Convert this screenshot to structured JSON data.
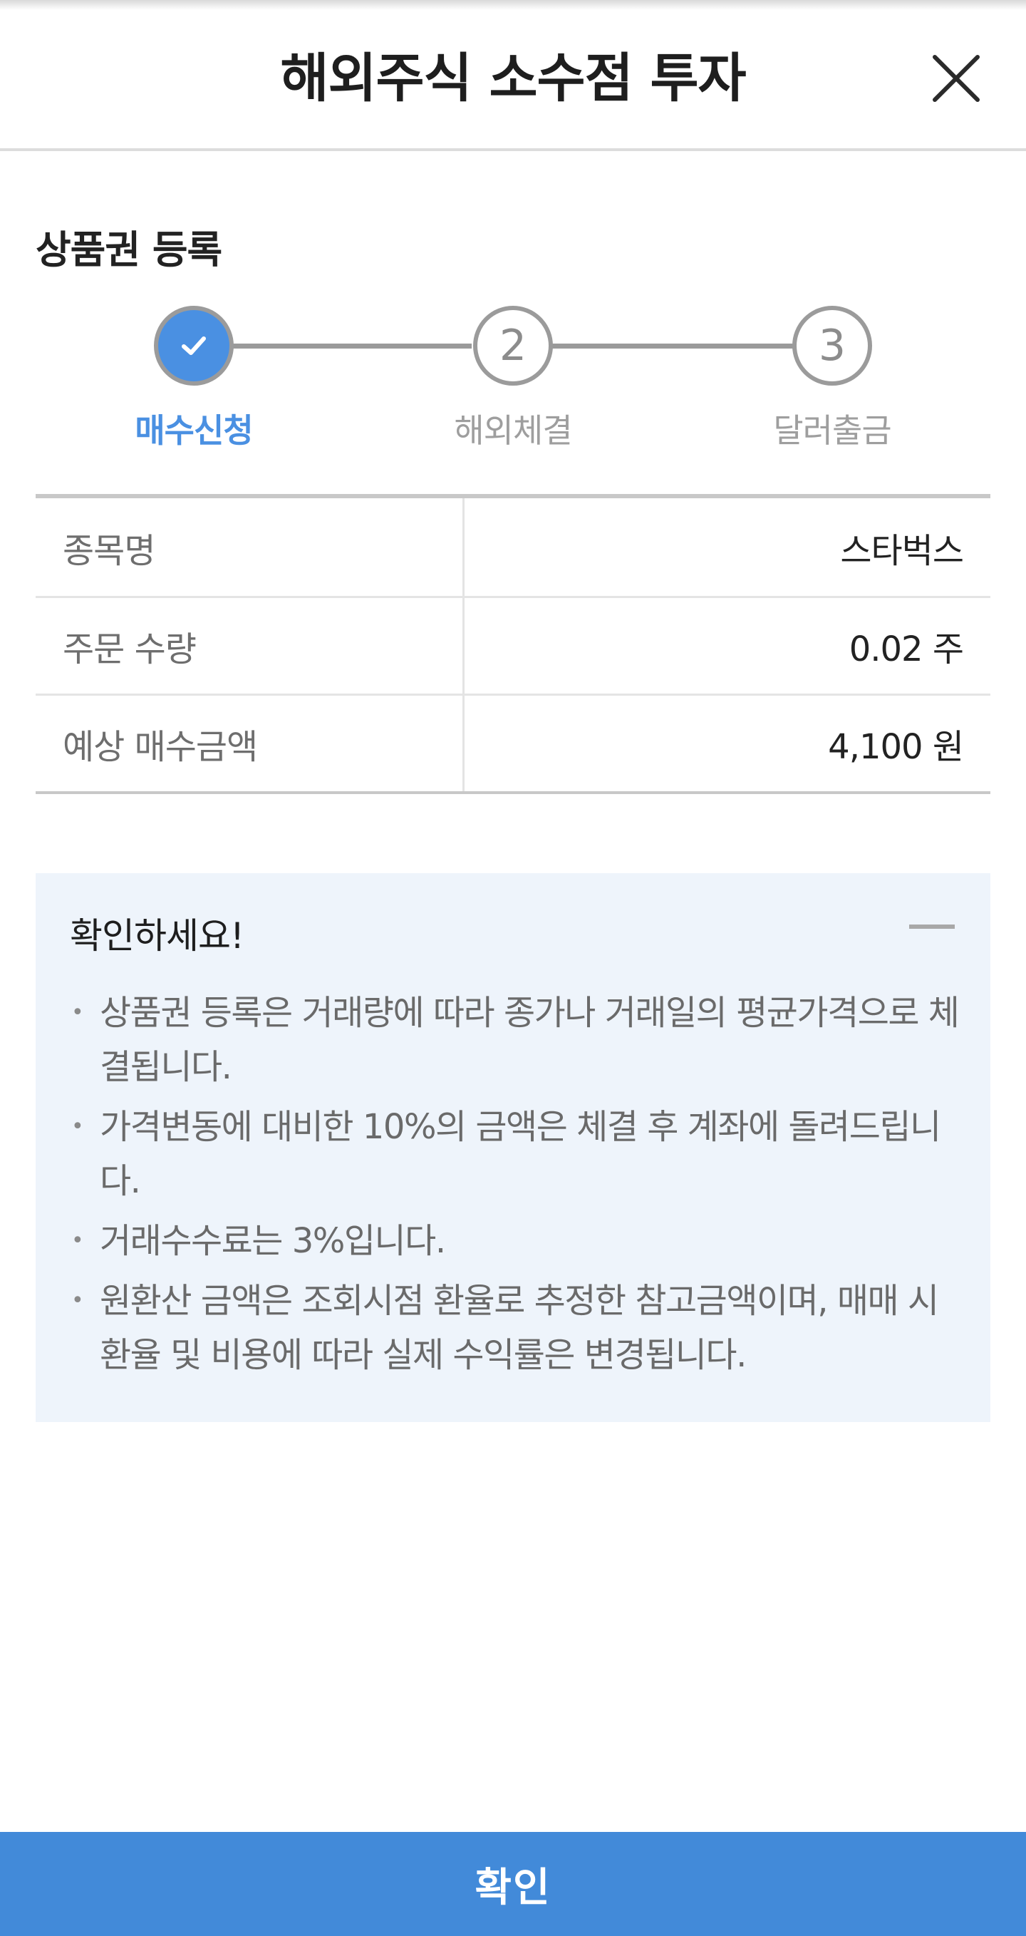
{
  "header": {
    "title": "해외주식 소수점 투자",
    "close_icon": "close-icon"
  },
  "section": {
    "title": "상품권 등록"
  },
  "stepper": {
    "active_color": "#4a90e2",
    "inactive_color": "#9b9b9b",
    "steps": [
      {
        "number": "",
        "label": "매수신청",
        "state": "done",
        "icon": "check-icon"
      },
      {
        "number": "2",
        "label": "해외체결",
        "state": "pending"
      },
      {
        "number": "3",
        "label": "달러출금",
        "state": "pending"
      }
    ]
  },
  "order_info": {
    "rows": [
      {
        "label": "종목명",
        "value": "스타벅스"
      },
      {
        "label": "주문 수량",
        "value": "0.02 주"
      },
      {
        "label": "예상 매수금액",
        "value": "4,100 원"
      }
    ]
  },
  "notice": {
    "title": "확인하세요!",
    "collapse_icon": "minus-icon",
    "items": [
      "상품권 등록은 거래량에 따라 종가나 거래일의 평균가격으로 체결됩니다.",
      "가격변동에 대비한 10%의 금액은 체결 후 계좌에 돌려드립니다.",
      "거래수수료는 3%입니다.",
      "원환산 금액은 조회시점 환율로 추정한 참고금액이며, 매매 시 환율 및 비용에 따라 실제 수익률은 변경됩니다."
    ]
  },
  "footer": {
    "confirm_label": "확인",
    "button_color": "#428ad9"
  }
}
